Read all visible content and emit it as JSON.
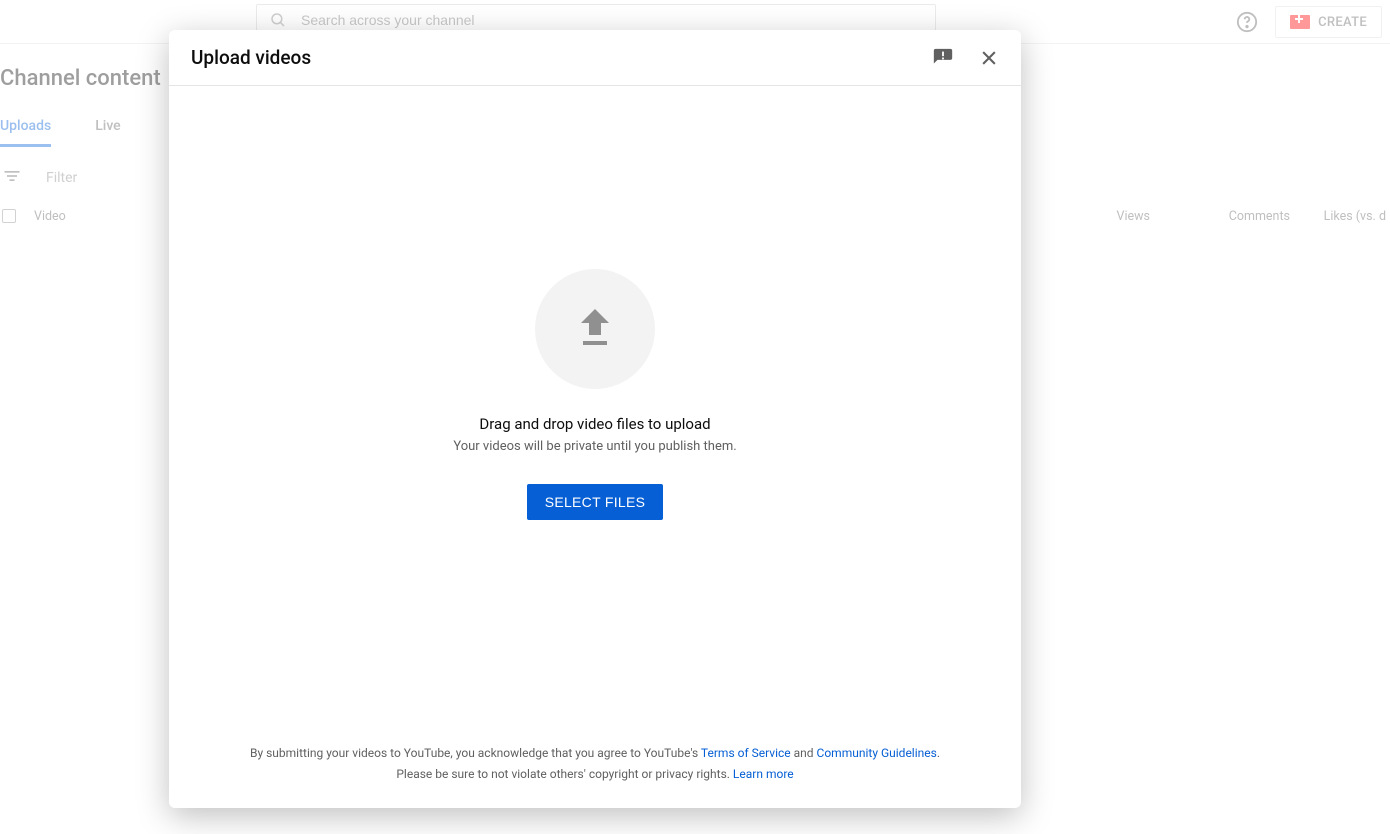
{
  "topbar": {
    "search_placeholder": "Search across your channel",
    "create_label": "CREATE"
  },
  "page": {
    "title": "Channel content",
    "tabs": {
      "uploads": "Uploads",
      "live": "Live"
    },
    "filter_placeholder": "Filter",
    "columns": {
      "video": "Video",
      "views": "Views",
      "comments": "Comments",
      "likes": "Likes (vs. d"
    }
  },
  "modal": {
    "title": "Upload videos",
    "drop_main": "Drag and drop video files to upload",
    "drop_sub": "Your videos will be private until you publish them.",
    "select_button": "SELECT FILES",
    "footer": {
      "pre": "By submitting your videos to YouTube, you acknowledge that you agree to YouTube's ",
      "tos": "Terms of Service",
      "and": " and ",
      "guidelines": "Community Guidelines",
      "period": ".",
      "line2_pre": "Please be sure to not violate others' copyright or privacy rights. ",
      "learn_more": "Learn more"
    }
  }
}
